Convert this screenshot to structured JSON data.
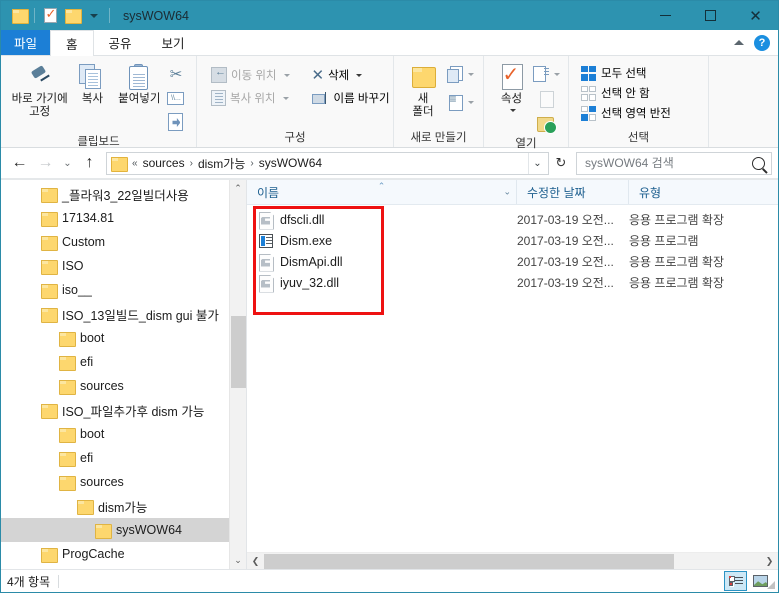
{
  "window": {
    "title": "sysWOW64",
    "quick_access": [
      "folder-icon",
      "properties-icon",
      "new-folder-icon",
      "customize-chevron"
    ],
    "controls": {
      "minimize": "—",
      "maximize": "□",
      "close": "✕"
    }
  },
  "ribbon": {
    "tabs": [
      {
        "id": "file",
        "label": "파일"
      },
      {
        "id": "home",
        "label": "홈",
        "active": true
      },
      {
        "id": "share",
        "label": "공유"
      },
      {
        "id": "view",
        "label": "보기"
      }
    ],
    "collapse_icon": "caret-up-icon",
    "help_icon": "help-icon",
    "groups": [
      {
        "id": "clipboard",
        "label": "클립보드",
        "big": [
          {
            "id": "pin-to-quick-access",
            "label": "바로 가기에\n고정",
            "line1": "바로 가기에",
            "line2": "고정"
          },
          {
            "id": "copy",
            "label": "복사",
            "line1": "복사",
            "line2": ""
          },
          {
            "id": "paste",
            "label": "붙여넣기",
            "line1": "붙여넣기",
            "line2": ""
          }
        ],
        "small": [
          {
            "id": "cut",
            "label": "잘라내기",
            "icon": "scissors-icon"
          },
          {
            "id": "copy-path",
            "label": "경로 복사",
            "icon": "copy-path-icon"
          },
          {
            "id": "paste-shortcut",
            "label": "바로 가기 붙여넣기",
            "icon": "paste-shortcut-icon"
          }
        ]
      },
      {
        "id": "organize",
        "label": "구성",
        "items": [
          {
            "id": "move-to",
            "label": "이동 위치",
            "disabled": true,
            "has_menu": true
          },
          {
            "id": "delete",
            "label": "삭제",
            "disabled": false,
            "has_menu": true
          },
          {
            "id": "copy-to",
            "label": "복사 위치",
            "disabled": true,
            "has_menu": true
          },
          {
            "id": "rename",
            "label": "이름 바꾸기",
            "disabled": false,
            "has_menu": false
          }
        ]
      },
      {
        "id": "new",
        "label": "새로 만들기",
        "big": [
          {
            "id": "new-folder",
            "line1": "새",
            "line2": "폴더"
          }
        ],
        "small": [
          {
            "id": "new-item",
            "label": "새 항목",
            "has_menu": true
          },
          {
            "id": "easy-access",
            "label": "쉬운 액세스",
            "has_menu": true
          }
        ]
      },
      {
        "id": "open",
        "label": "열기",
        "big": [
          {
            "id": "properties",
            "line1": "속성",
            "line2": ""
          }
        ],
        "small": [
          {
            "id": "open-with",
            "label": "열기",
            "has_menu": true
          },
          {
            "id": "edit",
            "label": "편집",
            "disabled": true
          },
          {
            "id": "history",
            "label": "히스토리"
          }
        ]
      },
      {
        "id": "select",
        "label": "선택",
        "items": [
          {
            "id": "select-all",
            "label": "모두 선택",
            "icon": "select-all-icon"
          },
          {
            "id": "select-none",
            "label": "선택 안 함",
            "icon": "select-none-icon"
          },
          {
            "id": "invert-selection",
            "label": "선택 영역 반전",
            "icon": "invert-selection-icon"
          }
        ]
      }
    ]
  },
  "addressbar": {
    "back_icon": "back-arrow-icon",
    "forward_icon": "forward-arrow-icon",
    "recent_icon": "recent-locations-icon",
    "up_icon": "up-arrow-icon",
    "breadcrumb_prefix": "«",
    "breadcrumbs": [
      "sources",
      "dism가능",
      "sysWOW64"
    ],
    "dropdown_icon": "chevron-down-icon",
    "refresh_icon": "refresh-icon",
    "search_placeholder": "sysWOW64 검색",
    "search_value": "",
    "search_icon": "search-icon"
  },
  "navpane": {
    "items": [
      {
        "label": "_플라워3_22일빌더사용",
        "depth": 1,
        "selected": false
      },
      {
        "label": "17134.81",
        "depth": 1,
        "selected": false
      },
      {
        "label": "Custom",
        "depth": 1,
        "selected": false
      },
      {
        "label": "ISO",
        "depth": 1,
        "selected": false
      },
      {
        "label": "iso__",
        "depth": 1,
        "selected": false
      },
      {
        "label": "ISO_13일빌드_dism gui 불가",
        "depth": 1,
        "selected": false
      },
      {
        "label": "boot",
        "depth": 2,
        "selected": false
      },
      {
        "label": "efi",
        "depth": 2,
        "selected": false
      },
      {
        "label": "sources",
        "depth": 2,
        "selected": false
      },
      {
        "label": "ISO_파일추가후 dism 가능",
        "depth": 1,
        "selected": false
      },
      {
        "label": "boot",
        "depth": 2,
        "selected": false
      },
      {
        "label": "efi",
        "depth": 2,
        "selected": false
      },
      {
        "label": "sources",
        "depth": 2,
        "selected": false
      },
      {
        "label": "dism가능",
        "depth": 3,
        "selected": false
      },
      {
        "label": "sysWOW64",
        "depth": 4,
        "selected": true
      },
      {
        "label": "ProgCache",
        "depth": 1,
        "selected": false
      }
    ]
  },
  "filelist": {
    "columns": [
      {
        "id": "name",
        "label": "이름",
        "sorted": "asc"
      },
      {
        "id": "date",
        "label": "수정한 날짜"
      },
      {
        "id": "type",
        "label": "유형"
      }
    ],
    "rows": [
      {
        "name": "dfscli.dll",
        "icon": "dll-file-icon",
        "date": "2017-03-19 오전...",
        "type": "응용 프로그램 확장"
      },
      {
        "name": "Dism.exe",
        "icon": "exe-file-icon",
        "date": "2017-03-19 오전...",
        "type": "응용 프로그램"
      },
      {
        "name": "DismApi.dll",
        "icon": "dll-file-icon",
        "date": "2017-03-19 오전...",
        "type": "응용 프로그램 확장"
      },
      {
        "name": "iyuv_32.dll",
        "icon": "dll-file-icon",
        "date": "2017-03-19 오전...",
        "type": "응용 프로그램 확장"
      }
    ],
    "highlight_color": "#ee1111"
  },
  "statusbar": {
    "item_count": "4개 항목",
    "views": [
      {
        "id": "details-view",
        "label": "자세히",
        "active": true
      },
      {
        "id": "thumbnail-view",
        "label": "큰 아이콘",
        "active": false
      }
    ]
  },
  "colors": {
    "titlebar": "#2d93b0",
    "file_tab": "#1c7fd6",
    "selection": "#d4d4d4",
    "column_header_text": "#1d5f8f"
  }
}
